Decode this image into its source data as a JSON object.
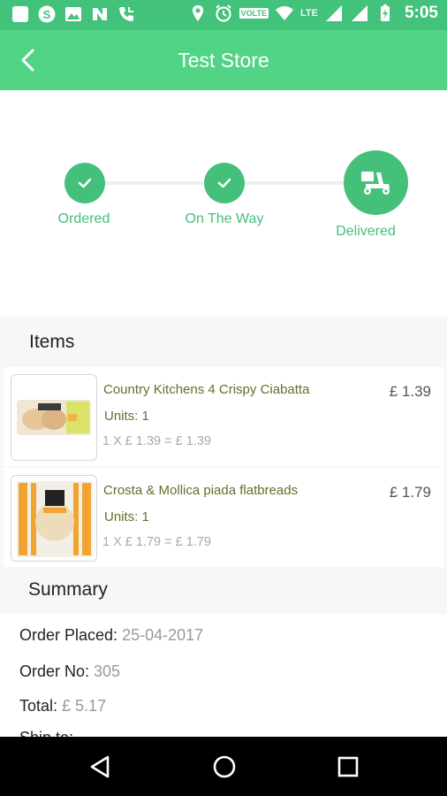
{
  "status_bar": {
    "time": "5:05",
    "volte": "VOLTE",
    "network": "LTE"
  },
  "app_bar": {
    "title": "Test Store"
  },
  "tracker": {
    "steps": [
      {
        "label": "Ordered",
        "state": "done",
        "icon": "check-icon"
      },
      {
        "label": "On The Way",
        "state": "done",
        "icon": "check-icon"
      },
      {
        "label": "Delivered",
        "state": "current",
        "icon": "scooter-icon"
      }
    ],
    "color": "#45c07a"
  },
  "items_section": {
    "title": "Items",
    "items": [
      {
        "name": "Country Kitchens 4 Crispy Ciabatta",
        "units": "Units: 1",
        "calc": "1 X £ 1.39 = £ 1.39",
        "price": "£ 1.39"
      },
      {
        "name": "Crosta & Mollica piada flatbreads",
        "units": "Units: 1",
        "calc": "1 X £ 1.79 = £ 1.79",
        "price": "£ 1.79"
      }
    ]
  },
  "summary_section": {
    "title": "Summary",
    "order_placed_label": "Order Placed: ",
    "order_placed_value": "25-04-2017",
    "order_no_label": "Order No: ",
    "order_no_value": "305",
    "total_label": "Total: ",
    "total_value": "£ 5.17",
    "ship_to_label": "Ship to:"
  },
  "colors": {
    "status_bar": "#42c27a",
    "app_bar": "#52d486",
    "accent": "#45c07a"
  }
}
